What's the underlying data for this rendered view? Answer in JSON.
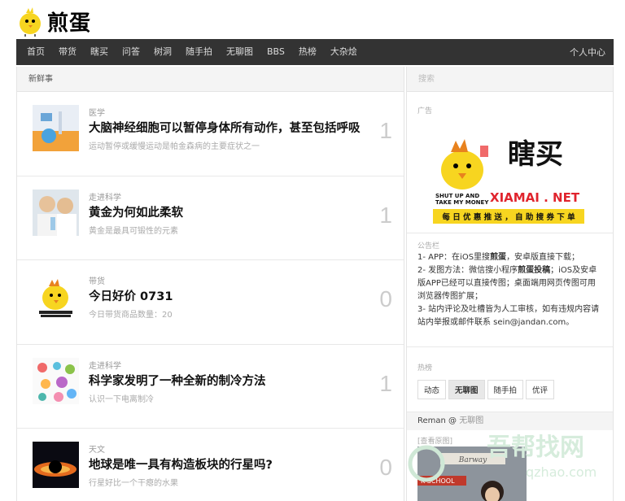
{
  "brand": {
    "name": "煎蛋"
  },
  "nav": {
    "items": [
      "首页",
      "带货",
      "瞎买",
      "问答",
      "树洞",
      "随手拍",
      "无聊图",
      "BBS",
      "热榜",
      "大杂烩"
    ],
    "user": "个人中心"
  },
  "main": {
    "heading": "新鲜事",
    "posts": [
      {
        "category": "医学",
        "title": "大脑神经细胞可以暂停身体所有动作，甚至包括呼吸",
        "summary": "运动暂停或缓慢运动是帕金森病的主要症状之一",
        "count": "1"
      },
      {
        "category": "走进科学",
        "title": "黄金为何如此柔软",
        "summary": "黄金是最具可锻性的元素",
        "count": "1"
      },
      {
        "category": "带货",
        "title": "今日好价 0731",
        "summary": "今日带货商品数量：20",
        "count": "0"
      },
      {
        "category": "走进科学",
        "title": "科学家发明了一种全新的制冷方法",
        "summary": "认识一下电离制冷",
        "count": "1"
      },
      {
        "category": "天文",
        "title": "地球是唯一具有构造板块的行星吗?",
        "summary": "行星好比一个干瘪的水果",
        "count": "0"
      }
    ]
  },
  "sidebar": {
    "search_placeholder": "搜索",
    "ad": {
      "label": "广告",
      "brand_cn": "瞎买",
      "brand_en": "XIAMAI . NET",
      "slogan_small_1": "SHUT UP AND",
      "slogan_small_2": "TAKE MY MONEY",
      "tagline": "每 日 优 惠 推 送 ， 自 助 搜 券 下 单"
    },
    "notice": {
      "label": "公告栏",
      "line1_a": "1- APP：在iOS里搜",
      "line1_b": "煎蛋",
      "line1_c": "，安卓版直接下载；",
      "line2_a": "2- 发图方法：微信搜小程序",
      "line2_b": "煎蛋投稿",
      "line2_c": "；iOS及安卓版APP已经可以直接传图；桌面端用网页传图可用浏览器传图扩展；",
      "line3": "3- 站内评论及吐槽皆为人工审核，如有违规内容请站内举报或邮件联系 sein@jandan.com。"
    },
    "hot": {
      "label": "热榜",
      "tabs": [
        "动态",
        "无聊图",
        "随手拍",
        "优评"
      ]
    },
    "recent": {
      "user": "Reman",
      "at": "@",
      "where": "无聊图",
      "view_original": "[查看原图]",
      "photo_sign_1": "Barway",
      "photo_sign_2": "K SCHOOL"
    },
    "watermark": {
      "cn": "吾帮找网",
      "url": "qzhao.com"
    }
  }
}
